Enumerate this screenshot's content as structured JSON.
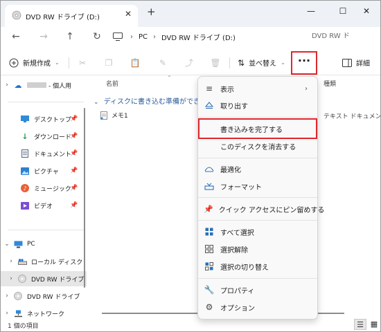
{
  "window": {
    "tab_title": "DVD RW ドライブ (D:)",
    "tab_close": "✕",
    "new_tab": "+",
    "minimize": "—",
    "maximize": "☐",
    "close": "✕"
  },
  "nav": {
    "back": "←",
    "forward": "→",
    "up": "↑",
    "refresh": "↻",
    "breadcrumb": [
      "PC",
      "DVD RW ドライブ (D:)"
    ],
    "search_placeholder": "DVD RW ド"
  },
  "toolbar": {
    "new_label": "新規作成",
    "sort_label": "並べ替え",
    "more_label": "···",
    "details_label": "詳細"
  },
  "sidebar": {
    "onedrive_label": "- 個人用",
    "quick": [
      {
        "label": "デスクトップ",
        "icon": "desktop-icon"
      },
      {
        "label": "ダウンロード",
        "icon": "download-icon"
      },
      {
        "label": "ドキュメント",
        "icon": "document-icon"
      },
      {
        "label": "ピクチャ",
        "icon": "pictures-icon"
      },
      {
        "label": "ミュージック",
        "icon": "music-icon"
      },
      {
        "label": "ビデオ",
        "icon": "video-icon"
      }
    ],
    "pc_label": "PC",
    "local_disk_label": "ローカル ディスク",
    "dvd_label": "DVD RW ドライブ",
    "dvd2_label": "DVD RW ドライブ",
    "network_label": "ネットワーク"
  },
  "content": {
    "col_name": "名前",
    "col_type": "種類",
    "group_label": "ディスクに書き込む準備ができ",
    "file_name": "メモ1",
    "file_type": "テキスト ドキュメント"
  },
  "menu": {
    "view": "表示",
    "eject": "取り出す",
    "finish_burning": "書き込みを完了する",
    "erase_disc": "このディスクを消去する",
    "optimize": "最適化",
    "format": "フォーマット",
    "pin_quick_access": "クイック アクセスにピン留めする",
    "select_all": "すべて選択",
    "select_none": "選択解除",
    "invert_selection": "選択の切り替え",
    "properties": "プロパティ",
    "options": "オプション"
  },
  "status": {
    "item_count": "1 個の項目"
  },
  "colors": {
    "accent": "#2b6fb8",
    "highlight_box": "#e0262c",
    "titlebar_bg": "#eef2f6"
  }
}
